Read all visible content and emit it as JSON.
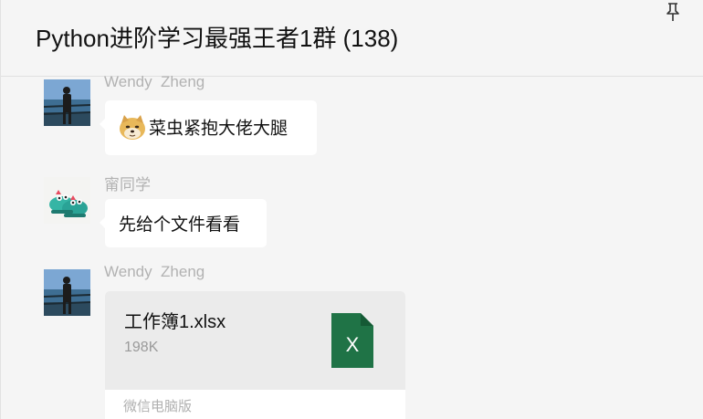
{
  "header": {
    "title": "Python进阶学习最强王者1群 (138)",
    "pin_icon": "pin-icon"
  },
  "messages": [
    {
      "sender": "Wendy  Zheng",
      "avatar": "avatar-man-silhouette",
      "emoji_icon": "doge-emoji",
      "text": "菜虫紧抱大佬大腿"
    },
    {
      "sender": "甯同学",
      "avatar": "avatar-green-shoes",
      "text": "先给个文件看看"
    },
    {
      "sender": "Wendy  Zheng",
      "avatar": "avatar-man-silhouette",
      "file": {
        "name": "工作簿1.xlsx",
        "size": "198K",
        "icon": "excel-file-icon",
        "icon_letter": "X",
        "source": "微信电脑版"
      }
    }
  ],
  "colors": {
    "background": "#f5f5f5",
    "bubble": "#ffffff",
    "excel_green": "#1f7346",
    "sender_gray": "#b2b2b2"
  }
}
